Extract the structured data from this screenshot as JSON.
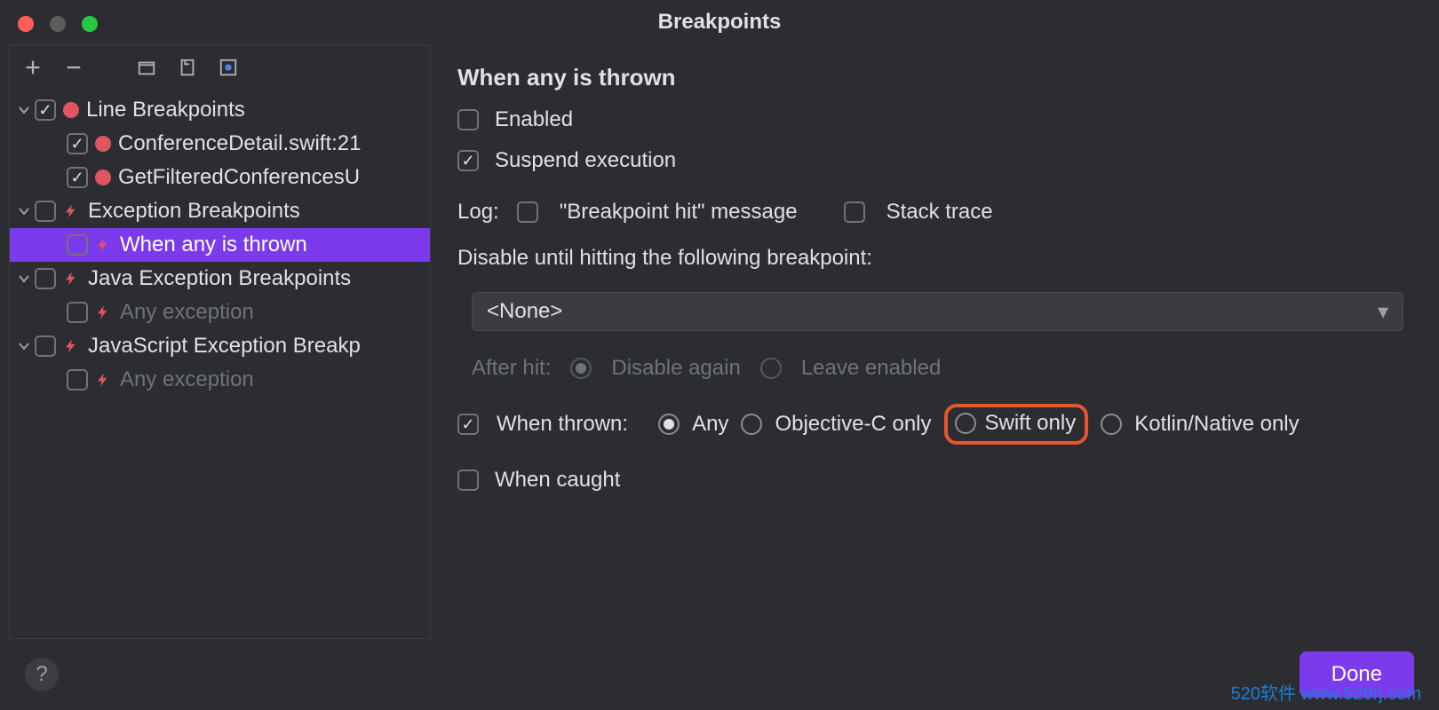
{
  "window": {
    "title": "Breakpoints"
  },
  "tree": {
    "groups": [
      {
        "label": "Line Breakpoints",
        "checked": true,
        "icon": "dot",
        "expanded": true,
        "items": [
          {
            "label": "ConferenceDetail.swift:21",
            "checked": true,
            "icon": "dot"
          },
          {
            "label": "GetFilteredConferencesU",
            "checked": true,
            "icon": "dot"
          }
        ]
      },
      {
        "label": "Exception Breakpoints",
        "checked": false,
        "icon": "bolt",
        "expanded": true,
        "items": [
          {
            "label": "When any is thrown",
            "checked": false,
            "icon": "bolt",
            "selected": true
          }
        ]
      },
      {
        "label": "Java Exception Breakpoints",
        "checked": false,
        "icon": "bolt",
        "expanded": true,
        "items": [
          {
            "label": "Any exception",
            "checked": false,
            "icon": "bolt",
            "dim": true
          }
        ]
      },
      {
        "label": "JavaScript Exception Breakp",
        "checked": false,
        "icon": "bolt",
        "expanded": true,
        "items": [
          {
            "label": "Any exception",
            "checked": false,
            "icon": "bolt",
            "dim": true
          }
        ]
      }
    ]
  },
  "detail": {
    "title": "When any is thrown",
    "enabled_label": "Enabled",
    "suspend_label": "Suspend execution",
    "log_label": "Log:",
    "bp_hit_label": "\"Breakpoint hit\" message",
    "stacktrace_label": "Stack trace",
    "disable_until_label": "Disable until hitting the following breakpoint:",
    "disable_until_value": "<None>",
    "after_hit_label": "After hit:",
    "after_hit_options": {
      "again": "Disable again",
      "leave": "Leave enabled"
    },
    "when_thrown_label": "When thrown:",
    "when_thrown_options": {
      "any": "Any",
      "objc": "Objective-C only",
      "swift": "Swift only",
      "kotlin": "Kotlin/Native only"
    },
    "when_caught_label": "When caught"
  },
  "footer": {
    "done": "Done"
  },
  "watermark": "520软件 www.520rj.com"
}
